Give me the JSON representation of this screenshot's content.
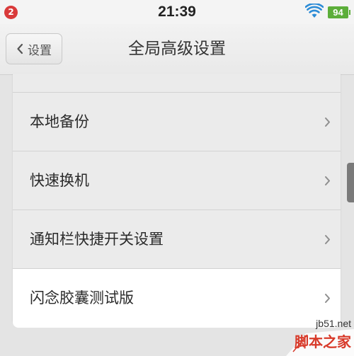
{
  "status_bar": {
    "notification_count": "2",
    "time": "21:39",
    "battery": "94",
    "wifi_icon": "wifi-icon"
  },
  "nav": {
    "back_label": "设置",
    "title": "全局高级设置"
  },
  "list": {
    "items": [
      {
        "label": "本地备份"
      },
      {
        "label": "快速换机"
      },
      {
        "label": "通知栏快捷开关设置"
      },
      {
        "label": "闪念胶囊测试版"
      }
    ]
  },
  "watermark": {
    "url": "jb51.net",
    "brand": "脚本之家"
  },
  "colors": {
    "badge": "#d93a3a",
    "battery": "#5cae3a",
    "wifi": "#2b8bd6",
    "highlight_row": "#ffffff",
    "watermark_brand": "#d83a2a"
  }
}
